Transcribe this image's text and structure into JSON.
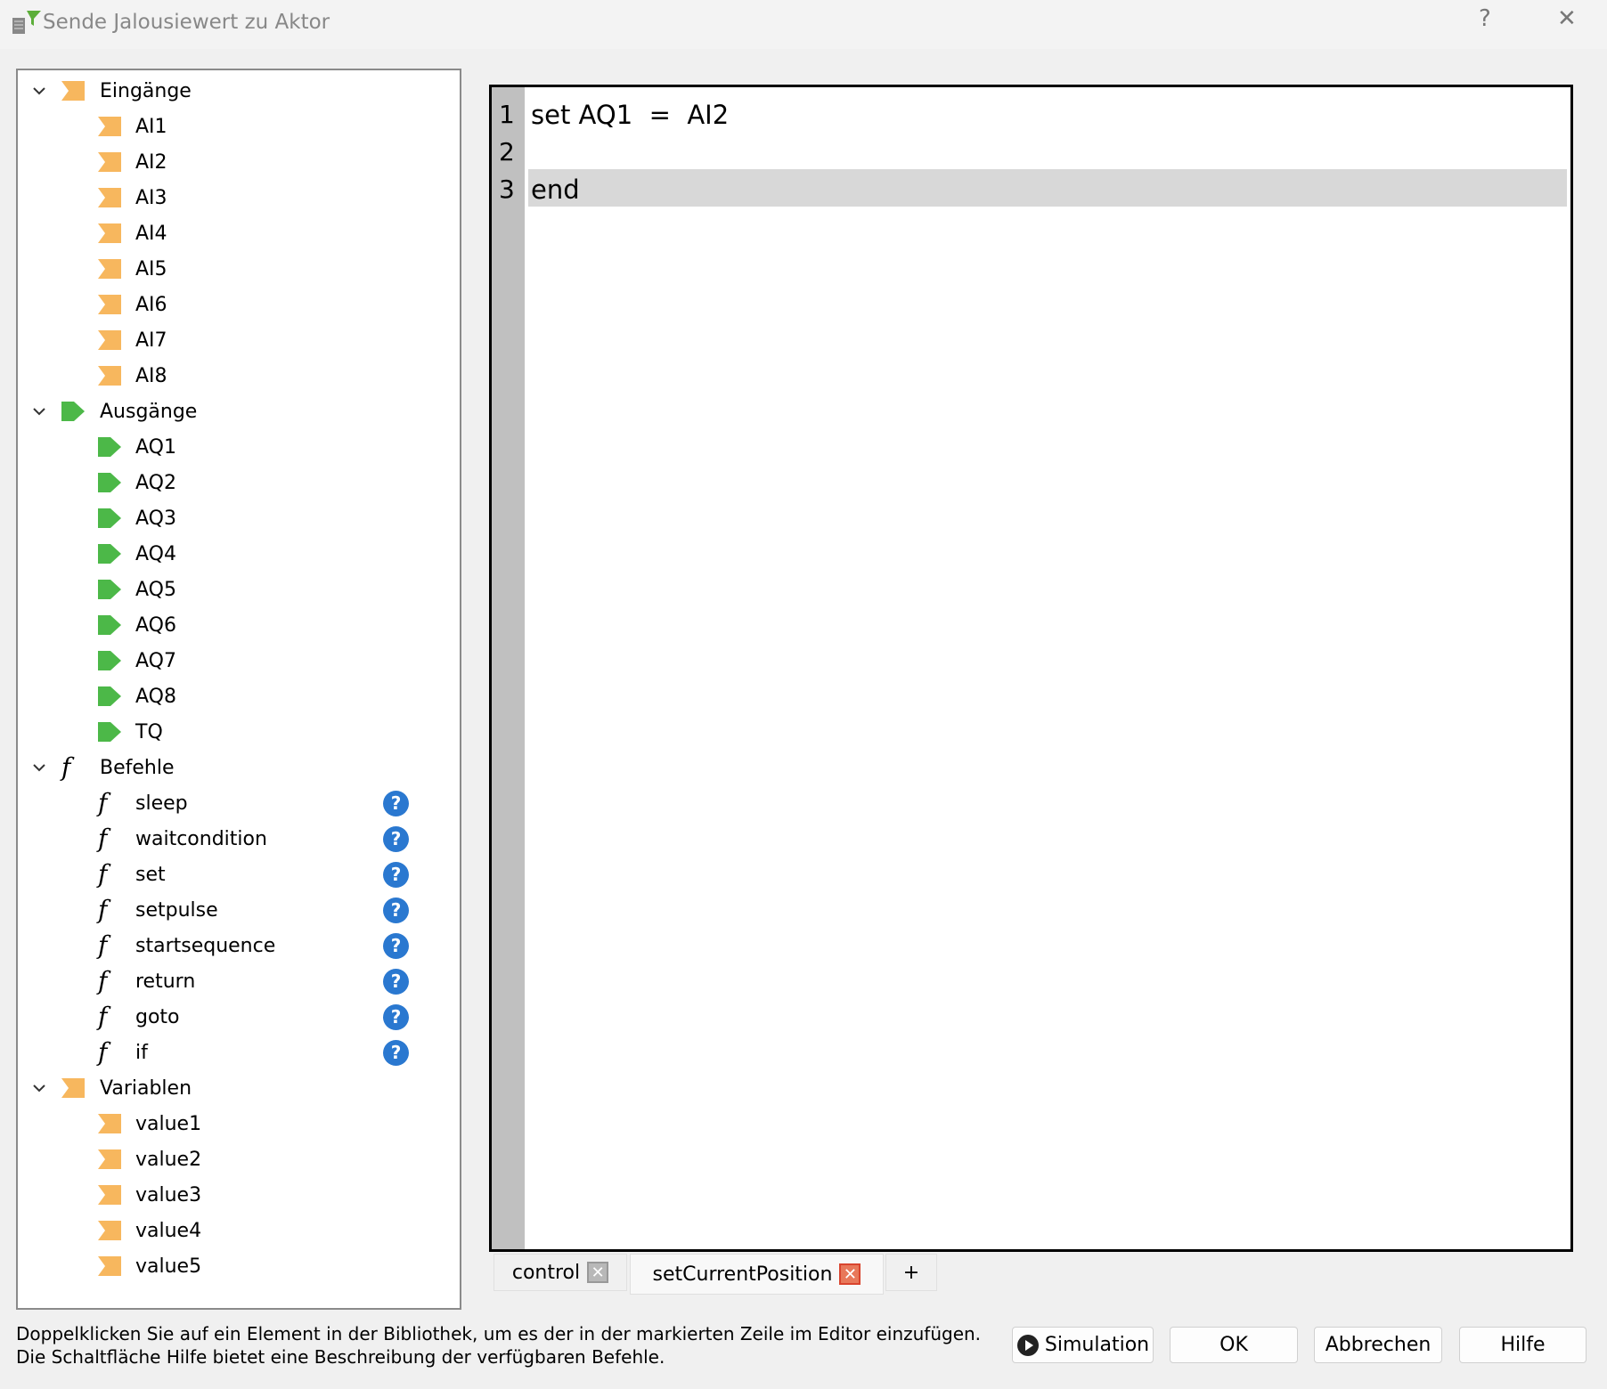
{
  "window": {
    "title": "Sende Jalousiewert zu Aktor",
    "help": "?",
    "close": "✕"
  },
  "tree": {
    "groups": [
      {
        "label": "Eingänge",
        "icon": "input-icon",
        "items": [
          "AI1",
          "AI2",
          "AI3",
          "AI4",
          "AI5",
          "AI6",
          "AI7",
          "AI8"
        ]
      },
      {
        "label": "Ausgänge",
        "icon": "output-icon",
        "items": [
          "AQ1",
          "AQ2",
          "AQ3",
          "AQ4",
          "AQ5",
          "AQ6",
          "AQ7",
          "AQ8",
          "TQ"
        ]
      },
      {
        "label": "Befehle",
        "icon": "function-icon",
        "items": [
          "sleep",
          "waitcondition",
          "set",
          "setpulse",
          "startsequence",
          "return",
          "goto",
          "if"
        ]
      },
      {
        "label": "Variablen",
        "icon": "input-icon",
        "items": [
          "value1",
          "value2",
          "value3",
          "value4",
          "value5"
        ]
      }
    ],
    "help_glyph": "?",
    "function_glyph": "f"
  },
  "editor": {
    "lines": [
      {
        "num": "1",
        "text": "set AQ1  =  AI2"
      },
      {
        "num": "2",
        "text": ""
      },
      {
        "num": "3",
        "text": "end"
      }
    ],
    "current_line": 3
  },
  "tabs": [
    {
      "label": "control",
      "active": false
    },
    {
      "label": "setCurrentPosition",
      "active": true
    }
  ],
  "add_tab": "+",
  "hint": {
    "line1": "Doppelklicken Sie auf ein Element in der Bibliothek, um es der in der markierten Zeile im Editor einzufügen.",
    "line2": "Die Schaltfläche Hilfe bietet eine Beschreibung der verfügbaren Befehle."
  },
  "buttons": {
    "simulation": "Simulation",
    "ok": "OK",
    "cancel": "Abbrechen",
    "help": "Hilfe"
  },
  "colors": {
    "input": "#f7b75e",
    "output": "#4cb848",
    "help": "#2a78d0",
    "close_active": "#e0533c"
  }
}
